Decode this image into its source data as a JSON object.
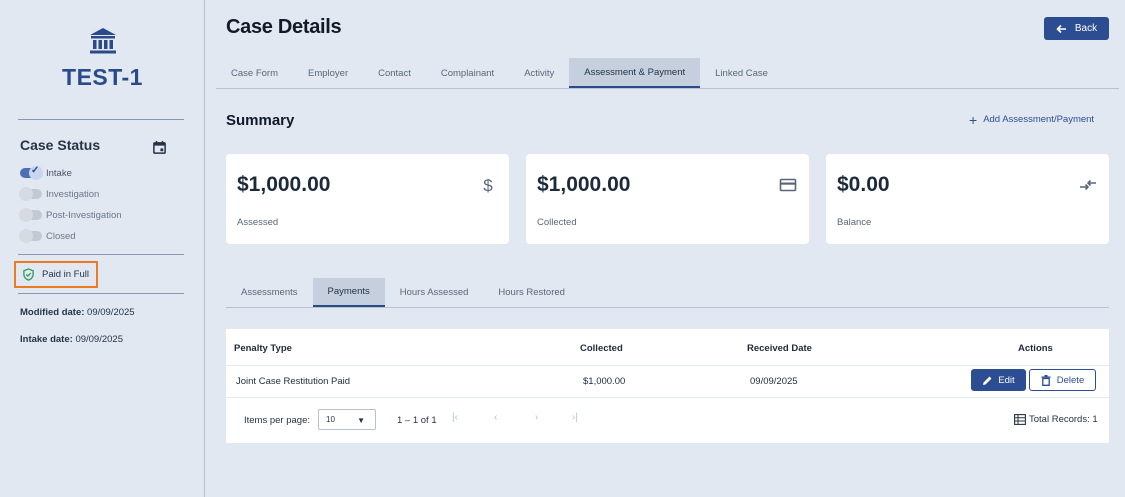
{
  "sidebar": {
    "case_id": "TEST-1",
    "status_title": "Case Status",
    "statuses": [
      {
        "label": "Intake",
        "on": true
      },
      {
        "label": "Investigation",
        "on": false
      },
      {
        "label": "Post-Investigation",
        "on": false
      },
      {
        "label": "Closed",
        "on": false
      }
    ],
    "paid_label": "Paid in Full",
    "modified_label": "Modified date:",
    "modified_value": "09/09/2025",
    "intake_label": "Intake date:",
    "intake_value": "09/09/2025"
  },
  "header": {
    "title": "Case Details",
    "back_label": "Back"
  },
  "tabs": [
    {
      "label": "Case Form",
      "active": false
    },
    {
      "label": "Employer",
      "active": false
    },
    {
      "label": "Contact",
      "active": false
    },
    {
      "label": "Complainant",
      "active": false
    },
    {
      "label": "Activity",
      "active": false
    },
    {
      "label": "Assessment & Payment",
      "active": true
    },
    {
      "label": "Linked Case",
      "active": false
    }
  ],
  "summary": {
    "title": "Summary",
    "add_label": "Add Assessment/Payment",
    "cards": [
      {
        "amount": "$1,000.00",
        "label": "Assessed",
        "icon": "dollar-icon"
      },
      {
        "amount": "$1,000.00",
        "label": "Collected",
        "icon": "credit-card-icon"
      },
      {
        "amount": "$0.00",
        "label": "Balance",
        "icon": "compare-arrows-icon"
      }
    ]
  },
  "sub_tabs": [
    {
      "label": "Assessments",
      "active": false
    },
    {
      "label": "Payments",
      "active": true
    },
    {
      "label": "Hours Assessed",
      "active": false
    },
    {
      "label": "Hours Restored",
      "active": false
    }
  ],
  "table": {
    "headers": {
      "penalty_type": "Penalty Type",
      "collected": "Collected",
      "received_date": "Received Date",
      "actions": "Actions"
    },
    "rows": [
      {
        "penalty_type": "Joint Case Restitution Paid",
        "collected": "$1,000.00",
        "received_date": "09/09/2025"
      }
    ],
    "edit_label": "Edit",
    "delete_label": "Delete"
  },
  "pager": {
    "items_per_page_label": "Items per page:",
    "per_page_value": "10",
    "range": "1 – 1 of 1",
    "total_label": "Total Records: 1"
  }
}
